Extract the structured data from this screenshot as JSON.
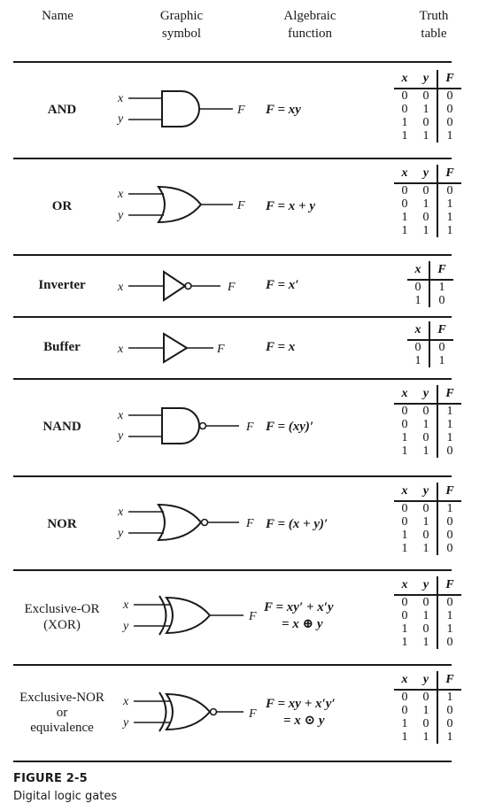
{
  "headers": {
    "name": "Name",
    "symbol_line1": "Graphic",
    "symbol_line2": "symbol",
    "algebraic_line1": "Algebraic",
    "algebraic_line2": "function",
    "truth_line1": "Truth",
    "truth_line2": "table"
  },
  "gates": [
    {
      "name": "AND",
      "name_sub1": "",
      "name_sub2": "",
      "symbol": "and-gate-icon",
      "inputs": [
        "x",
        "y"
      ],
      "output": "F",
      "function_line1": "F = xy",
      "function_line2": "",
      "table_headers": [
        "x",
        "y",
        "F"
      ],
      "table_rows": [
        [
          "0",
          "0",
          "0"
        ],
        [
          "0",
          "1",
          "0"
        ],
        [
          "1",
          "0",
          "0"
        ],
        [
          "1",
          "1",
          "1"
        ]
      ]
    },
    {
      "name": "OR",
      "name_sub1": "",
      "name_sub2": "",
      "symbol": "or-gate-icon",
      "inputs": [
        "x",
        "y"
      ],
      "output": "F",
      "function_line1": "F = x + y",
      "function_line2": "",
      "table_headers": [
        "x",
        "y",
        "F"
      ],
      "table_rows": [
        [
          "0",
          "0",
          "0"
        ],
        [
          "0",
          "1",
          "1"
        ],
        [
          "1",
          "0",
          "1"
        ],
        [
          "1",
          "1",
          "1"
        ]
      ]
    },
    {
      "name": "Inverter",
      "name_sub1": "",
      "name_sub2": "",
      "symbol": "inverter-gate-icon",
      "inputs": [
        "x"
      ],
      "output": "F",
      "function_line1": "F = x′",
      "function_line2": "",
      "table_headers": [
        "x",
        "F"
      ],
      "table_rows": [
        [
          "0",
          "1"
        ],
        [
          "1",
          "0"
        ]
      ]
    },
    {
      "name": "Buffer",
      "name_sub1": "",
      "name_sub2": "",
      "symbol": "buffer-gate-icon",
      "inputs": [
        "x"
      ],
      "output": "F",
      "function_line1": "F = x",
      "function_line2": "",
      "table_headers": [
        "x",
        "F"
      ],
      "table_rows": [
        [
          "0",
          "0"
        ],
        [
          "1",
          "1"
        ]
      ]
    },
    {
      "name": "NAND",
      "name_sub1": "",
      "name_sub2": "",
      "symbol": "nand-gate-icon",
      "inputs": [
        "x",
        "y"
      ],
      "output": "F",
      "function_line1": "F = (xy)′",
      "function_line2": "",
      "table_headers": [
        "x",
        "y",
        "F"
      ],
      "table_rows": [
        [
          "0",
          "0",
          "1"
        ],
        [
          "0",
          "1",
          "1"
        ],
        [
          "1",
          "0",
          "1"
        ],
        [
          "1",
          "1",
          "0"
        ]
      ]
    },
    {
      "name": "NOR",
      "name_sub1": "",
      "name_sub2": "",
      "symbol": "nor-gate-icon",
      "inputs": [
        "x",
        "y"
      ],
      "output": "F",
      "function_line1": "F = (x + y)′",
      "function_line2": "",
      "table_headers": [
        "x",
        "y",
        "F"
      ],
      "table_rows": [
        [
          "0",
          "0",
          "1"
        ],
        [
          "0",
          "1",
          "0"
        ],
        [
          "1",
          "0",
          "0"
        ],
        [
          "1",
          "1",
          "0"
        ]
      ]
    },
    {
      "name": "Exclusive-OR",
      "name_sub1": "(XOR)",
      "name_sub2": "",
      "symbol": "xor-gate-icon",
      "inputs": [
        "x",
        "y"
      ],
      "output": "F",
      "function_line1": "F = xy′ + x′y",
      "function_line2": "= x ⊕ y",
      "table_headers": [
        "x",
        "y",
        "F"
      ],
      "table_rows": [
        [
          "0",
          "0",
          "0"
        ],
        [
          "0",
          "1",
          "1"
        ],
        [
          "1",
          "0",
          "1"
        ],
        [
          "1",
          "1",
          "0"
        ]
      ]
    },
    {
      "name": "Exclusive-NOR",
      "name_sub1": "or",
      "name_sub2": "equivalence",
      "symbol": "xnor-gate-icon",
      "inputs": [
        "x",
        "y"
      ],
      "output": "F",
      "function_line1": "F = xy + x′y′",
      "function_line2": "= x ⊙ y",
      "table_headers": [
        "x",
        "y",
        "F"
      ],
      "table_rows": [
        [
          "0",
          "0",
          "1"
        ],
        [
          "0",
          "1",
          "0"
        ],
        [
          "1",
          "0",
          "0"
        ],
        [
          "1",
          "1",
          "1"
        ]
      ]
    }
  ],
  "caption": {
    "title": "FIGURE 2-5",
    "subtitle": "Digital logic gates"
  }
}
